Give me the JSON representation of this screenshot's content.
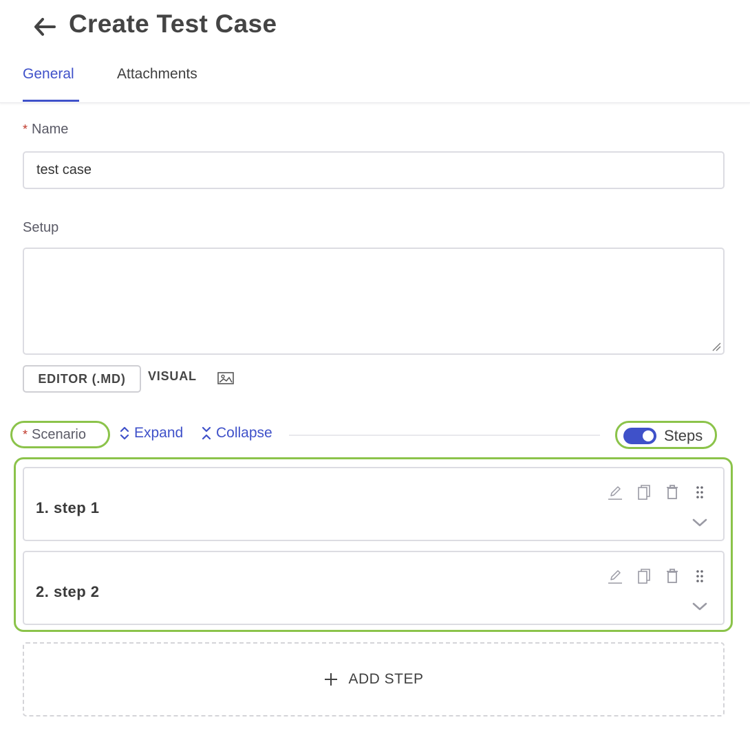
{
  "header": {
    "back_icon": "arrow-left-icon",
    "title": "Create Test Case",
    "tabs": [
      {
        "label": "General",
        "active": true
      },
      {
        "label": "Attachments",
        "active": false
      }
    ]
  },
  "form": {
    "name": {
      "required_mark": "*",
      "label": "Name",
      "value": "test case"
    },
    "setup": {
      "label": "Setup",
      "value": ""
    },
    "editor_modes": {
      "editor_label": "EDITOR (.MD)",
      "visual_label": "VISUAL",
      "image_icon": "image-icon"
    }
  },
  "scenario": {
    "required_mark": "*",
    "label": "Scenario",
    "expand_label": "Expand",
    "collapse_label": "Collapse",
    "steps_toggle": {
      "label": "Steps",
      "on": true
    },
    "steps": [
      {
        "title": "1. step 1"
      },
      {
        "title": "2. step 2"
      }
    ],
    "add_step_label": "ADD STEP"
  },
  "colors": {
    "accent": "#3f51c9",
    "highlight": "#8bc34a",
    "required": "#c0392b"
  }
}
